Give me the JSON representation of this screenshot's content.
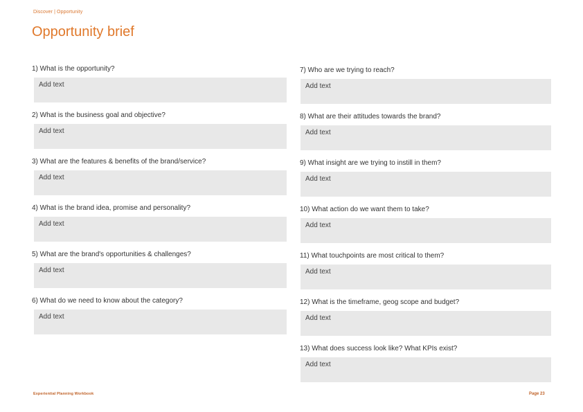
{
  "header": {
    "breadcrumb": "Discover | Opportunity",
    "title": "Opportunity brief"
  },
  "answer_placeholder": "Add text",
  "left_column": [
    {
      "question": "1) What is the opportunity?",
      "answer": "Add text"
    },
    {
      "question": "2) What is the business goal and objective?",
      "answer": "Add text"
    },
    {
      "question": "3) What are the features & benefits of the brand/service?",
      "answer": "Add text"
    },
    {
      "question": "4)  What is the brand idea, promise and personality?",
      "answer": "Add text"
    },
    {
      "question": "5) What are the brand's opportunities & challenges?",
      "answer": "Add text"
    },
    {
      "question": "6) What do we need to know about the category?",
      "answer": "Add text"
    }
  ],
  "right_column": [
    {
      "question": "7) Who are we trying to reach?",
      "answer": "Add text"
    },
    {
      "question": "8) What are their attitudes towards the brand?",
      "answer": "Add text"
    },
    {
      "question": "9) What insight are we trying to instill in them?",
      "answer": "Add text"
    },
    {
      "question": "10) What action do we want them to take?",
      "answer": "Add text"
    },
    {
      "question": "11) What touchpoints are most critical to them?",
      "answer": "Add text"
    },
    {
      "question": "12) What is the timeframe, geog scope and budget?",
      "answer": "Add text"
    },
    {
      "question": "13) What does success look like? What KPIs exist?",
      "answer": "Add text"
    }
  ],
  "footer": {
    "document_name": "Experiential Planning Workbook",
    "page_label": "Page 23"
  },
  "colors": {
    "accent": "#E0782A",
    "box_background": "#E8E8E8",
    "text": "#333333"
  }
}
